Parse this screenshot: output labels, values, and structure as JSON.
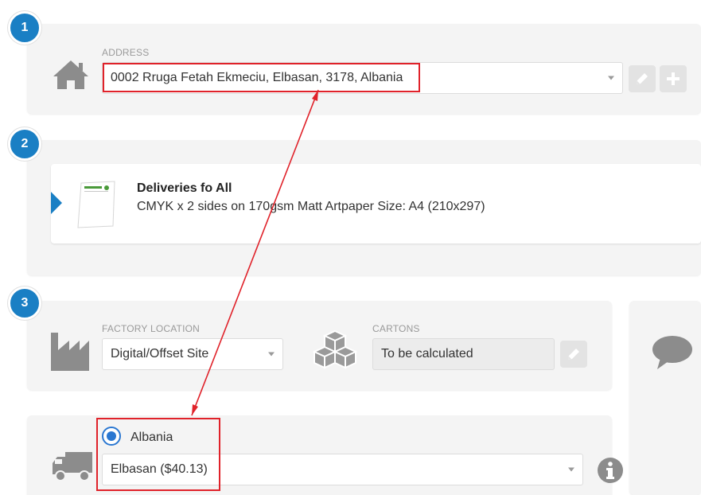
{
  "steps": [
    "1",
    "2",
    "3"
  ],
  "address": {
    "label": "ADDRESS",
    "value": "0002 Rruga Fetah Ekmeciu, Elbasan, 3178, Albania"
  },
  "product": {
    "title": "Deliveries fo All",
    "description": "CMYK x 2 sides on 170gsm Matt Artpaper Size: A4 (210x297)"
  },
  "factory": {
    "label": "FACTORY LOCATION",
    "value": "Digital/Offset Site"
  },
  "cartons": {
    "label": "CARTONS",
    "value": "To be calculated"
  },
  "shipping": {
    "country": "Albania",
    "option": "Elbasan ($40.13)"
  },
  "icons": {
    "address": "home-icon",
    "edit": "pencil-icon",
    "add": "plus-icon",
    "factory": "factory-icon",
    "cartons": "boxes-icon",
    "comment": "speech-bubble-icon",
    "truck": "truck-icon",
    "info": "info-icon"
  },
  "colors": {
    "step_badge": "#1a7fc4",
    "highlight": "#e0222a",
    "radio": "#2a77d1"
  }
}
